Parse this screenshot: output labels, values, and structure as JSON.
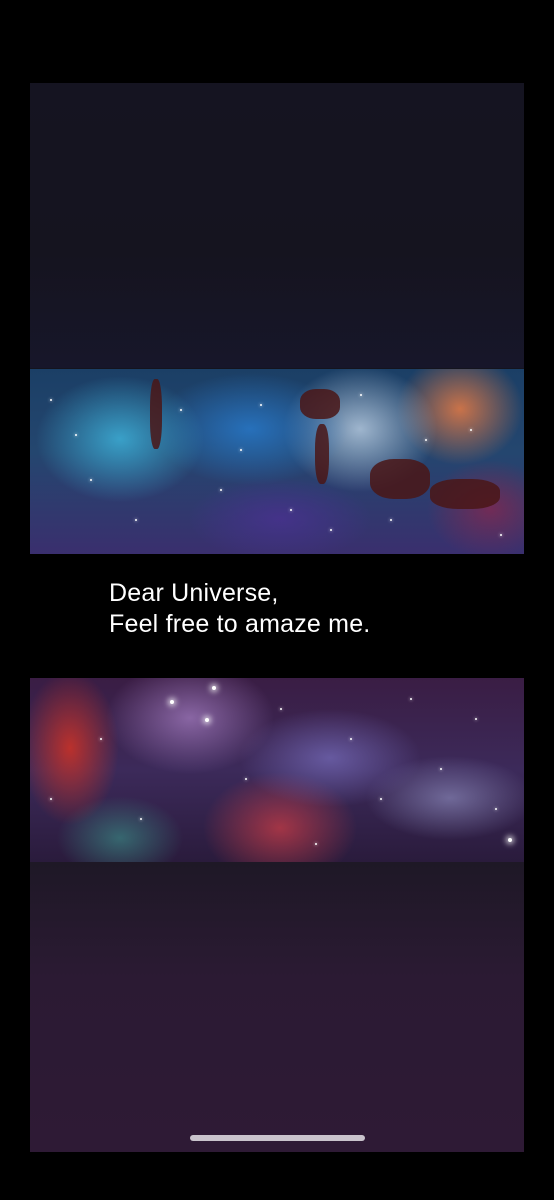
{
  "caption": {
    "line1": "Dear Universe,",
    "line2": "Feel free to amaze me."
  },
  "images": {
    "top": "nebula-photo",
    "bottom": "nebula-photo"
  },
  "colors": {
    "background": "#000000",
    "top_panel": "#15141f",
    "caption_band": "#000000",
    "caption_text": "#ffffff",
    "bottom_panel": "#2e1a35",
    "home_indicator": "#c9c3cc"
  }
}
